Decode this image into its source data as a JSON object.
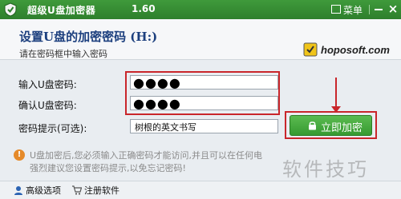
{
  "titlebar": {
    "title": "超级U盘加密器",
    "version": "1.60",
    "menu_label": "菜单",
    "close_symbol": "×",
    "accent": "#3a9136"
  },
  "header": {
    "title": "设置U盘的加密密码 (H:)",
    "hint": "请在密码框中输入密码",
    "brand": "hoposoft.com"
  },
  "form": {
    "password_label": "输入U盘密码:",
    "password_value": "●●●●",
    "confirm_label": "确认U盘密码:",
    "confirm_value": "●●●●",
    "hint_label": "密码提示(可选):",
    "hint_value": "树根的英文书写"
  },
  "encrypt_button": {
    "label": "立即加密",
    "color": "#43a83c"
  },
  "notice": {
    "icon": "warning-icon",
    "line1": "U盘加密后,您必须输入正确密码才能访问,并且可以在任何电",
    "line2": "强烈建议您设置密码提示,以免忘记密码!"
  },
  "footer": {
    "advanced_label": "高级选项",
    "register_label": "注册软件"
  },
  "watermark": "软件技巧",
  "highlight_color": "#c9262b"
}
